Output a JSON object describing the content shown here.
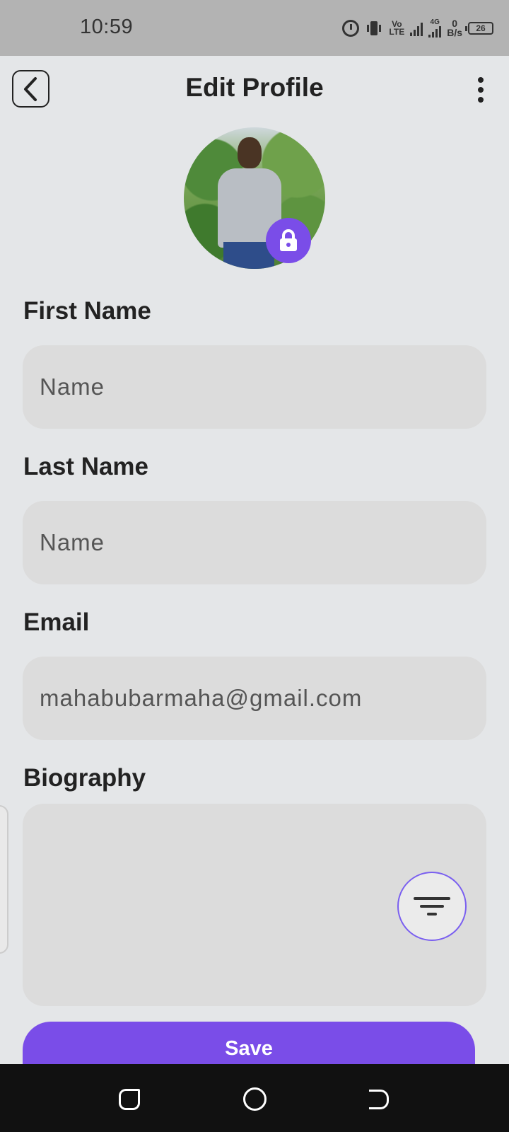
{
  "status_bar": {
    "time": "10:59",
    "volte_top": "Vo",
    "volte_bottom": "LTE",
    "network": "4G",
    "data_rate_value": "0",
    "data_rate_unit": "B/s",
    "battery": "26"
  },
  "header": {
    "title": "Edit Profile"
  },
  "form": {
    "first_name": {
      "label": "First Name",
      "placeholder": "Name",
      "value": ""
    },
    "last_name": {
      "label": "Last Name",
      "placeholder": "Name",
      "value": ""
    },
    "email": {
      "label": "Email",
      "placeholder": "",
      "value": "mahabubarmaha@gmail.com"
    },
    "biography": {
      "label": "Biography",
      "value": ""
    }
  },
  "actions": {
    "save_label": "Save"
  },
  "colors": {
    "accent": "#7a4de8",
    "background": "#e4e6e8",
    "field_background": "#dcdcdc"
  },
  "icons": {
    "back": "chevron-left-icon",
    "more": "more-vert-icon",
    "avatar_badge": "lock-icon",
    "fab": "filter-icon"
  }
}
